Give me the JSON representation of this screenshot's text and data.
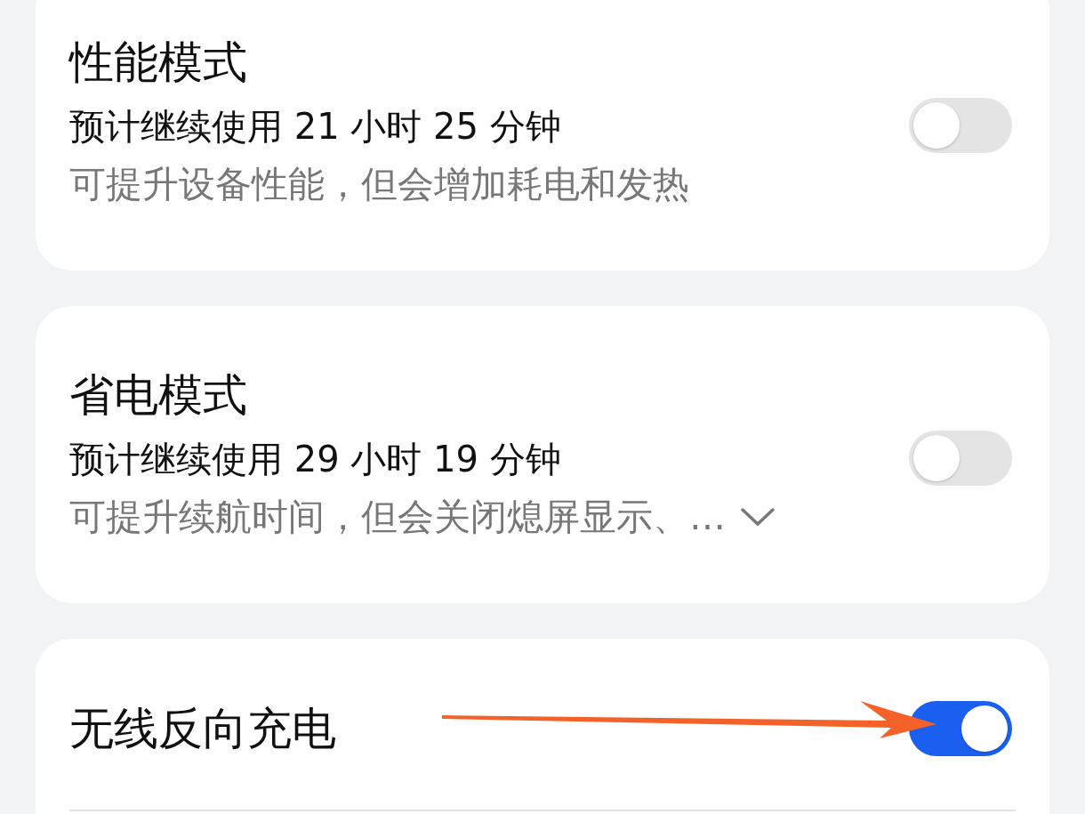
{
  "settings": [
    {
      "title": "性能模式",
      "estimate": "预计继续使用 21 小时 25 分钟",
      "description": "可提升设备性能，但会增加耗电和发热",
      "expandable": false,
      "on": false,
      "divider": false
    },
    {
      "title": "省电模式",
      "estimate": "预计继续使用 29 小时 19 分钟",
      "description": "可提升续航时间，但会关闭熄屏显示、…",
      "expandable": true,
      "on": false,
      "divider": false
    },
    {
      "title": "无线反向充电",
      "on": true,
      "divider": true
    }
  ],
  "annotation": {
    "kind": "arrow"
  }
}
